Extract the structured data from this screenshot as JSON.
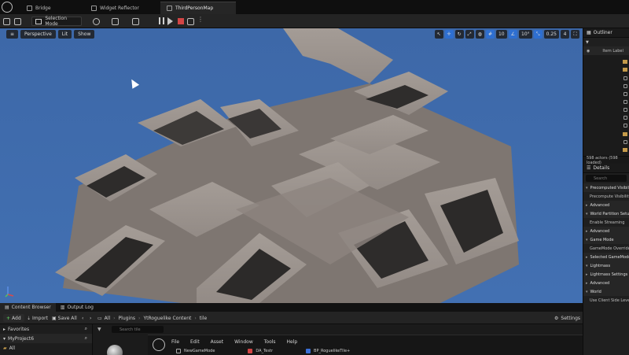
{
  "tabs": [
    {
      "label": "Bridge"
    },
    {
      "label": "Widget Reflector"
    },
    {
      "label": "ThirdPersonMap"
    }
  ],
  "toolbar": {
    "selection_mode": "Selection Mode"
  },
  "viewport": {
    "perspective": "Perspective",
    "lit": "Lit",
    "show": "Show",
    "grid_snap": "10",
    "rotate_snap": "10°",
    "scale_snap": "0.25",
    "camera_speed": "4"
  },
  "outliner": {
    "title": "Outliner",
    "item_label": "Item Label",
    "actor_count": "598 actors (598 loaded)"
  },
  "details": {
    "title": "Details",
    "search_placeholder": "Search",
    "rows": [
      {
        "label": "Precomputed Visibility",
        "section": true
      },
      {
        "label": "Precompute Visibility",
        "section": false
      },
      {
        "label": "Advanced",
        "section": true,
        "collapsed": true
      },
      {
        "label": "World Partition Setup",
        "section": true
      },
      {
        "label": "Enable Streaming",
        "section": false
      },
      {
        "label": "Advanced",
        "section": true,
        "collapsed": true
      },
      {
        "label": "Game Mode",
        "section": true
      },
      {
        "label": "GameMode Override",
        "section": false
      },
      {
        "label": "Selected GameMode",
        "section": true,
        "collapsed": true
      },
      {
        "label": "Lightmass",
        "section": true
      },
      {
        "label": "Lightmass Settings",
        "section": true,
        "collapsed": true
      },
      {
        "label": "Advanced",
        "section": true,
        "collapsed": true
      },
      {
        "label": "World",
        "section": true
      },
      {
        "label": "Use Client Side Level",
        "section": false
      }
    ]
  },
  "bottom": {
    "tabs": [
      {
        "label": "Content Browser"
      },
      {
        "label": "Output Log"
      }
    ],
    "add": "Add",
    "import": "Import",
    "save_all": "Save All",
    "breadcrumb": [
      "All",
      "Plugins",
      "YtRoguelike Content",
      "tile"
    ],
    "settings": "Settings",
    "favorites": "Favorites",
    "project": "MyProject6",
    "all": "All",
    "search_placeholder": "Search tile",
    "menu": [
      "File",
      "Edit",
      "Asset",
      "Window",
      "Tools",
      "Help"
    ],
    "files": [
      "NewGameMode",
      "DA_Testr",
      "BP_RoguelikeTile+"
    ]
  }
}
